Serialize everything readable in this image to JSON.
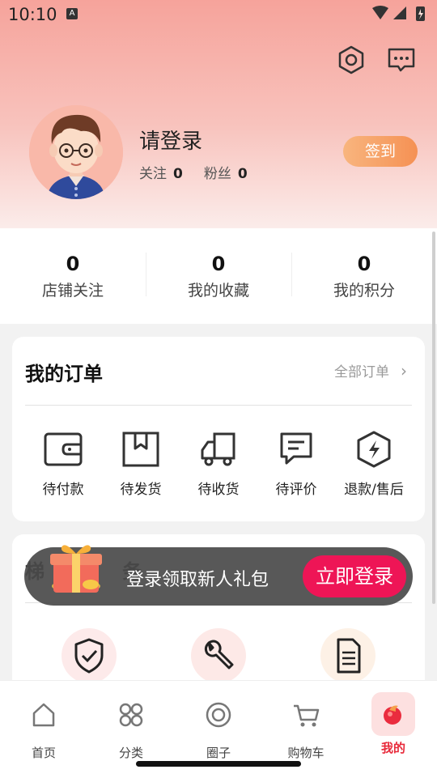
{
  "status_bar": {
    "time": "10:10",
    "notification_icon": "A"
  },
  "header": {
    "settings_icon": "gear-hex-icon",
    "message_icon": "chat-icon"
  },
  "profile": {
    "username": "请登录",
    "follow_label": "关注",
    "follow_count": "0",
    "fans_label": "粉丝",
    "fans_count": "0",
    "checkin_label": "签到"
  },
  "stats": [
    {
      "value": "0",
      "label": "店铺关注"
    },
    {
      "value": "0",
      "label": "我的收藏"
    },
    {
      "value": "0",
      "label": "我的积分"
    }
  ],
  "orders": {
    "title": "我的订单",
    "all_link": "全部订单",
    "items": [
      {
        "label": "待付款",
        "icon": "wallet-icon"
      },
      {
        "label": "待发货",
        "icon": "box-icon"
      },
      {
        "label": "待收货",
        "icon": "truck-icon"
      },
      {
        "label": "待评价",
        "icon": "comment-icon"
      },
      {
        "label": "退款/售后",
        "icon": "refund-icon"
      }
    ]
  },
  "ladder": {
    "title_visible": "梯",
    "title_visible_end": "务",
    "services": [
      "shield-check-icon",
      "wrench-icon",
      "document-icon"
    ]
  },
  "login_banner": {
    "text": "登录领取新人礼包",
    "button": "立即登录"
  },
  "nav": [
    {
      "label": "首页",
      "icon": "home-icon"
    },
    {
      "label": "分类",
      "icon": "category-icon"
    },
    {
      "label": "圈子",
      "icon": "circle-target-icon"
    },
    {
      "label": "购物车",
      "icon": "cart-icon"
    },
    {
      "label": "我的",
      "icon": "profile-active-icon"
    }
  ],
  "colors": {
    "accent": "#ee1556",
    "nav_active": "#e8293a",
    "checkin": "#f59154"
  }
}
